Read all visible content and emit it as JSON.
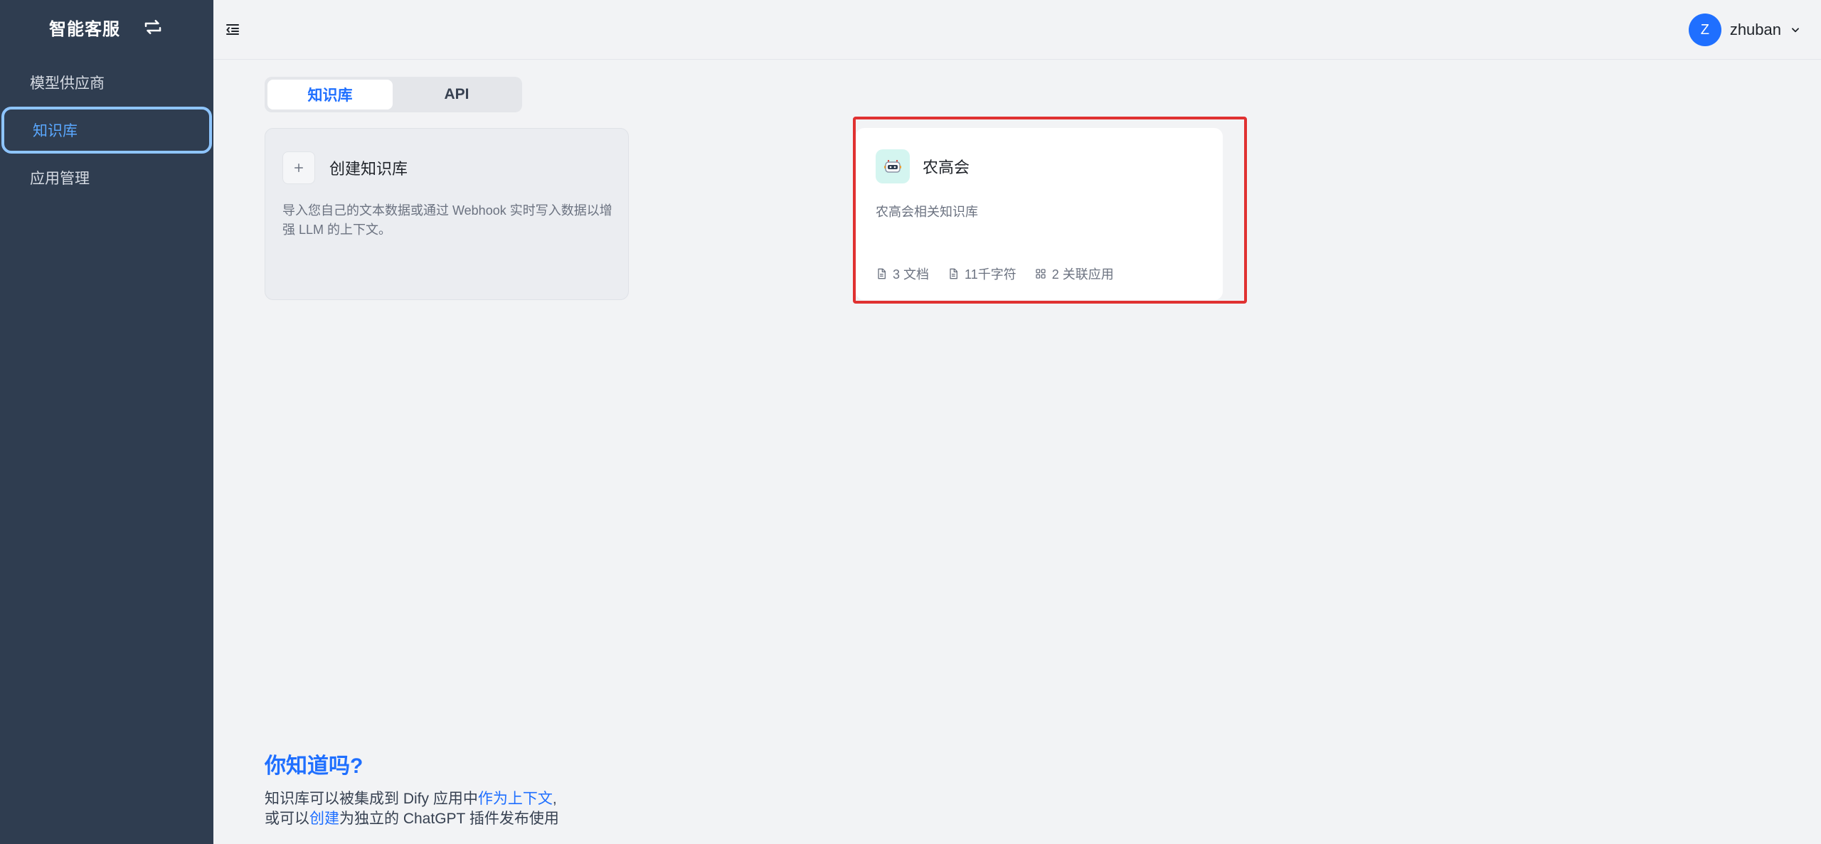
{
  "sidebar": {
    "brand": "智能客服",
    "items": [
      {
        "label": "模型供应商"
      },
      {
        "label": "知识库"
      },
      {
        "label": "应用管理"
      }
    ]
  },
  "header": {
    "user": {
      "initial": "Z",
      "name": "zhuban"
    }
  },
  "tabs": [
    {
      "label": "知识库"
    },
    {
      "label": "API"
    }
  ],
  "create_card": {
    "title": "创建知识库",
    "description": "导入您自己的文本数据或通过 Webhook 实时写入数据以增强 LLM 的上下文。"
  },
  "knowledge_bases": [
    {
      "title": "农高会",
      "description": "农高会相关知识库",
      "docs": "3 文档",
      "chars": "11千字符",
      "apps": "2 关联应用"
    }
  ],
  "tip": {
    "title": "你知道吗?",
    "line1_a": "知识库可以被集成到 Dify 应用中",
    "line1_link": "作为上下文",
    "line1_b": ",",
    "line2_a": "或可以",
    "line2_link": "创建",
    "line2_b": "为独立的 ChatGPT 插件发布使用"
  },
  "colors": {
    "sidebar_bg": "#2f3d50",
    "accent": "#1f6fff",
    "highlight": "#e03131"
  }
}
